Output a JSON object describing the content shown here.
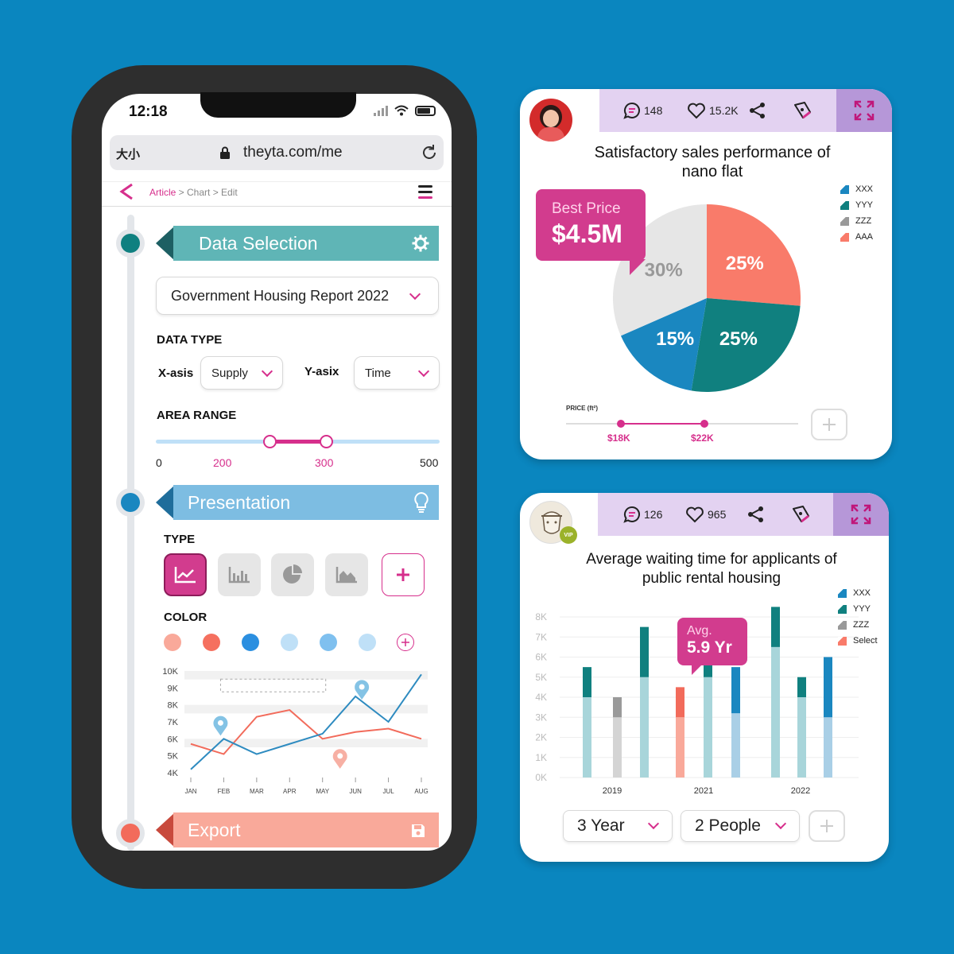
{
  "phone": {
    "status": {
      "time": "12:18"
    },
    "browser": {
      "size_label": "大小",
      "url": "theyta.com/me"
    },
    "breadcrumb": {
      "first": "Article",
      "rest": " > Chart > Edit"
    },
    "data_selection": {
      "title": "Data Selection",
      "dataset": "Government Housing Report 2022",
      "data_type_label": "DATA TYPE",
      "x_label": "X-asis",
      "x_value": "Supply",
      "y_label": "Y-asix",
      "y_value": "Time",
      "area_range_label": "AREA RANGE",
      "range_min": "0",
      "range_low": "200",
      "range_high": "300",
      "range_max": "500",
      "range_low_value": 200,
      "range_high_value": 300,
      "range_max_value": 500
    },
    "presentation": {
      "title": "Presentation",
      "type_label": "TYPE",
      "color_label": "COLOR",
      "colors": [
        "#f9a99a",
        "#f5705f",
        "#2b8fe0",
        "#bfe0f7",
        "#7fc0ef",
        "#bfe0f7"
      ]
    },
    "export": {
      "title": "Export"
    }
  },
  "card1": {
    "comments": "148",
    "likes": "15.2K",
    "title_line1": "Satisfactory sales performance of",
    "title_line2": "nano flat",
    "tooltip_label": "Best Price",
    "tooltip_value": "$4.5M",
    "price_label": "PRICE (ft²)",
    "price_low": "$18K",
    "price_high": "$22K"
  },
  "card2": {
    "comments": "126",
    "likes": "965",
    "title_line1": "Average waiting time for applicants of",
    "title_line2": "public rental housing",
    "vip": "VIP",
    "tooltip_label": "Avg.",
    "tooltip_value": "5.9 Yr",
    "filter_years": "3 Year",
    "filter_people": "2 People"
  },
  "chart_data": [
    {
      "type": "line",
      "x": [
        "JAN",
        "FEB",
        "MAR",
        "APR",
        "MAY",
        "JUN",
        "JUL",
        "AUG"
      ],
      "yticks": [
        "10K",
        "9K",
        "8K",
        "7K",
        "6K",
        "5K",
        "4K"
      ],
      "ylim": [
        4000,
        10000
      ],
      "series": [
        {
          "color": "#f26b5b",
          "values": [
            5700,
            5100,
            7300,
            7700,
            6000,
            6400,
            6600,
            6000
          ]
        },
        {
          "color": "#2e8bc0",
          "values": [
            4200,
            6000,
            5100,
            5700,
            6300,
            8500,
            7000,
            9800
          ]
        }
      ],
      "grid": true
    },
    {
      "type": "pie",
      "labels": [
        "30%",
        "25%",
        "25%",
        "15%"
      ],
      "values": [
        30,
        25,
        25,
        15
      ],
      "colors": [
        "#e6e6e6",
        "#f97b6a",
        "#10807f",
        "#1a87c0"
      ],
      "legend": [
        "XXX",
        "YYY",
        "ZZZ",
        "AAA"
      ],
      "legend_colors": [
        "#1a87c0",
        "#10807f",
        "#999999",
        "#f97b6a"
      ],
      "legend_position": "top-right"
    },
    {
      "type": "bar",
      "xlabels": [
        "2019",
        "2021",
        "2022"
      ],
      "yticks": [
        "8K",
        "7K",
        "6K",
        "5K",
        "4K",
        "3K",
        "2K",
        "1K",
        "0K"
      ],
      "ylim": [
        0,
        8000
      ],
      "legend": [
        "XXX",
        "YYY",
        "ZZZ",
        "Select"
      ],
      "legend_colors": [
        "#1a87c0",
        "#10807f",
        "#999999",
        "#f97b6a"
      ],
      "legend_position": "top-right",
      "bars": [
        {
          "base": 4000,
          "top": 5500,
          "base_color": "#a8d5da",
          "top_color": "#10807f"
        },
        {
          "base": 3000,
          "top": 4000,
          "base_color": "#d4d4d4",
          "top_color": "#9a9a9a"
        },
        {
          "base": 5000,
          "top": 7500,
          "base_color": "#a8d5da",
          "top_color": "#10807f"
        },
        {
          "base": 3000,
          "top": 4500,
          "base_color": "#f9a99a",
          "top_color": "#f26b5b"
        },
        {
          "base": 5000,
          "top": 6000,
          "base_color": "#a8d5da",
          "top_color": "#10807f"
        },
        {
          "base": 3200,
          "top": 5500,
          "base_color": "#a9cfe6",
          "top_color": "#1a87c0"
        },
        {
          "base": 6500,
          "top": 8500,
          "base_color": "#a8d5da",
          "top_color": "#10807f"
        },
        {
          "base": 4000,
          "top": 5000,
          "base_color": "#a8d5da",
          "top_color": "#10807f"
        },
        {
          "base": 3000,
          "top": 6000,
          "base_color": "#a9cfe6",
          "top_color": "#1a87c0"
        }
      ]
    }
  ]
}
